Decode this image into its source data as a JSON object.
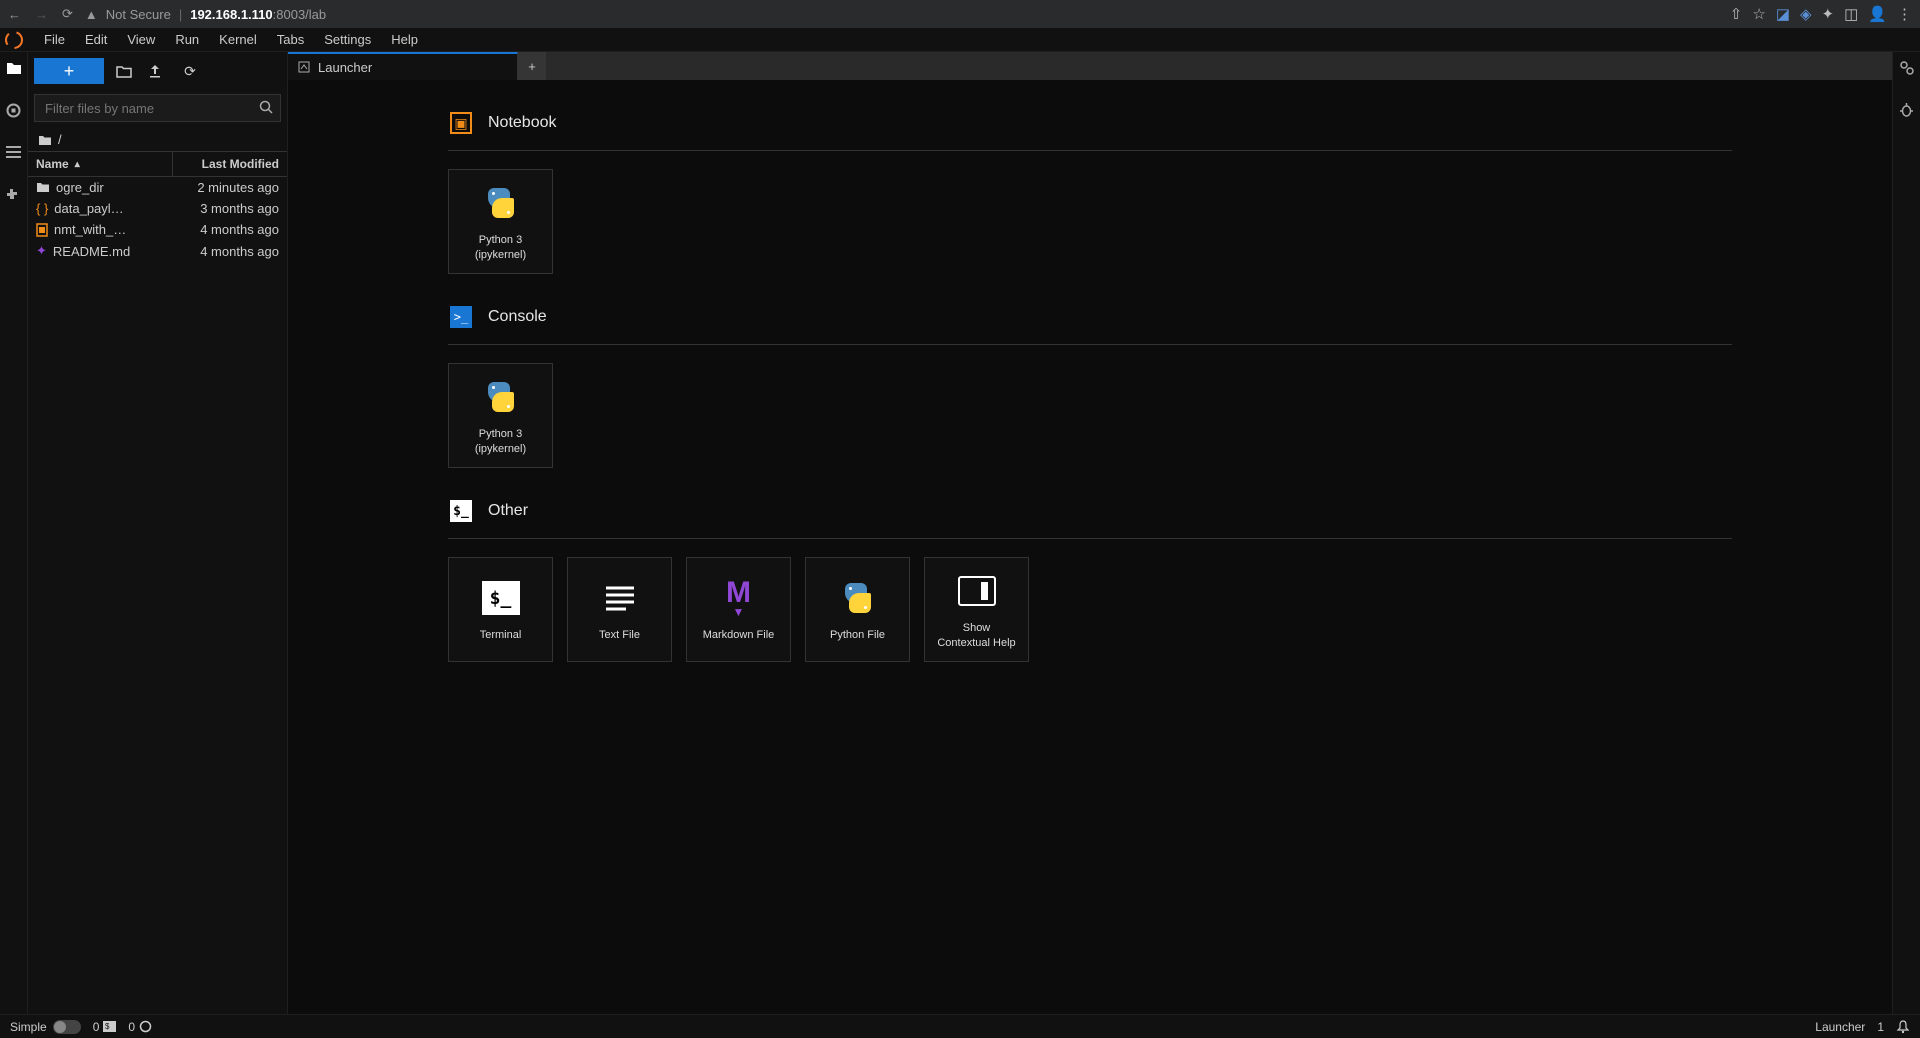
{
  "browser": {
    "not_secure": "Not Secure",
    "url_host": "192.168.1.110",
    "url_path": ":8003/lab"
  },
  "menu": {
    "file": "File",
    "edit": "Edit",
    "view": "View",
    "run": "Run",
    "kernel": "Kernel",
    "tabs": "Tabs",
    "settings": "Settings",
    "help": "Help"
  },
  "filebrowser": {
    "filter_placeholder": "Filter files by name",
    "breadcrumb": "/",
    "col_name": "Name",
    "col_modified": "Last Modified",
    "rows": [
      {
        "name": "ogre_dir",
        "modified": "2 minutes ago",
        "type": "folder"
      },
      {
        "name": "data_payl…",
        "modified": "3 months ago",
        "type": "code"
      },
      {
        "name": "nmt_with_…",
        "modified": "4 months ago",
        "type": "notebook"
      },
      {
        "name": "README.md",
        "modified": "4 months ago",
        "type": "markdown"
      }
    ]
  },
  "tabs": {
    "launcher": "Launcher",
    "add": "+"
  },
  "launcher": {
    "sections": {
      "notebook": {
        "title": "Notebook",
        "card": "Python 3\n(ipykernel)"
      },
      "console": {
        "title": "Console",
        "card": "Python 3\n(ipykernel)"
      },
      "other": {
        "title": "Other",
        "cards": {
          "terminal": "Terminal",
          "text": "Text File",
          "markdown": "Markdown File",
          "python": "Python File",
          "help": "Show\nContextual Help"
        }
      }
    }
  },
  "status": {
    "simple": "Simple",
    "terminals": "0",
    "kernels": "0",
    "mode": "Launcher",
    "count": "1"
  }
}
